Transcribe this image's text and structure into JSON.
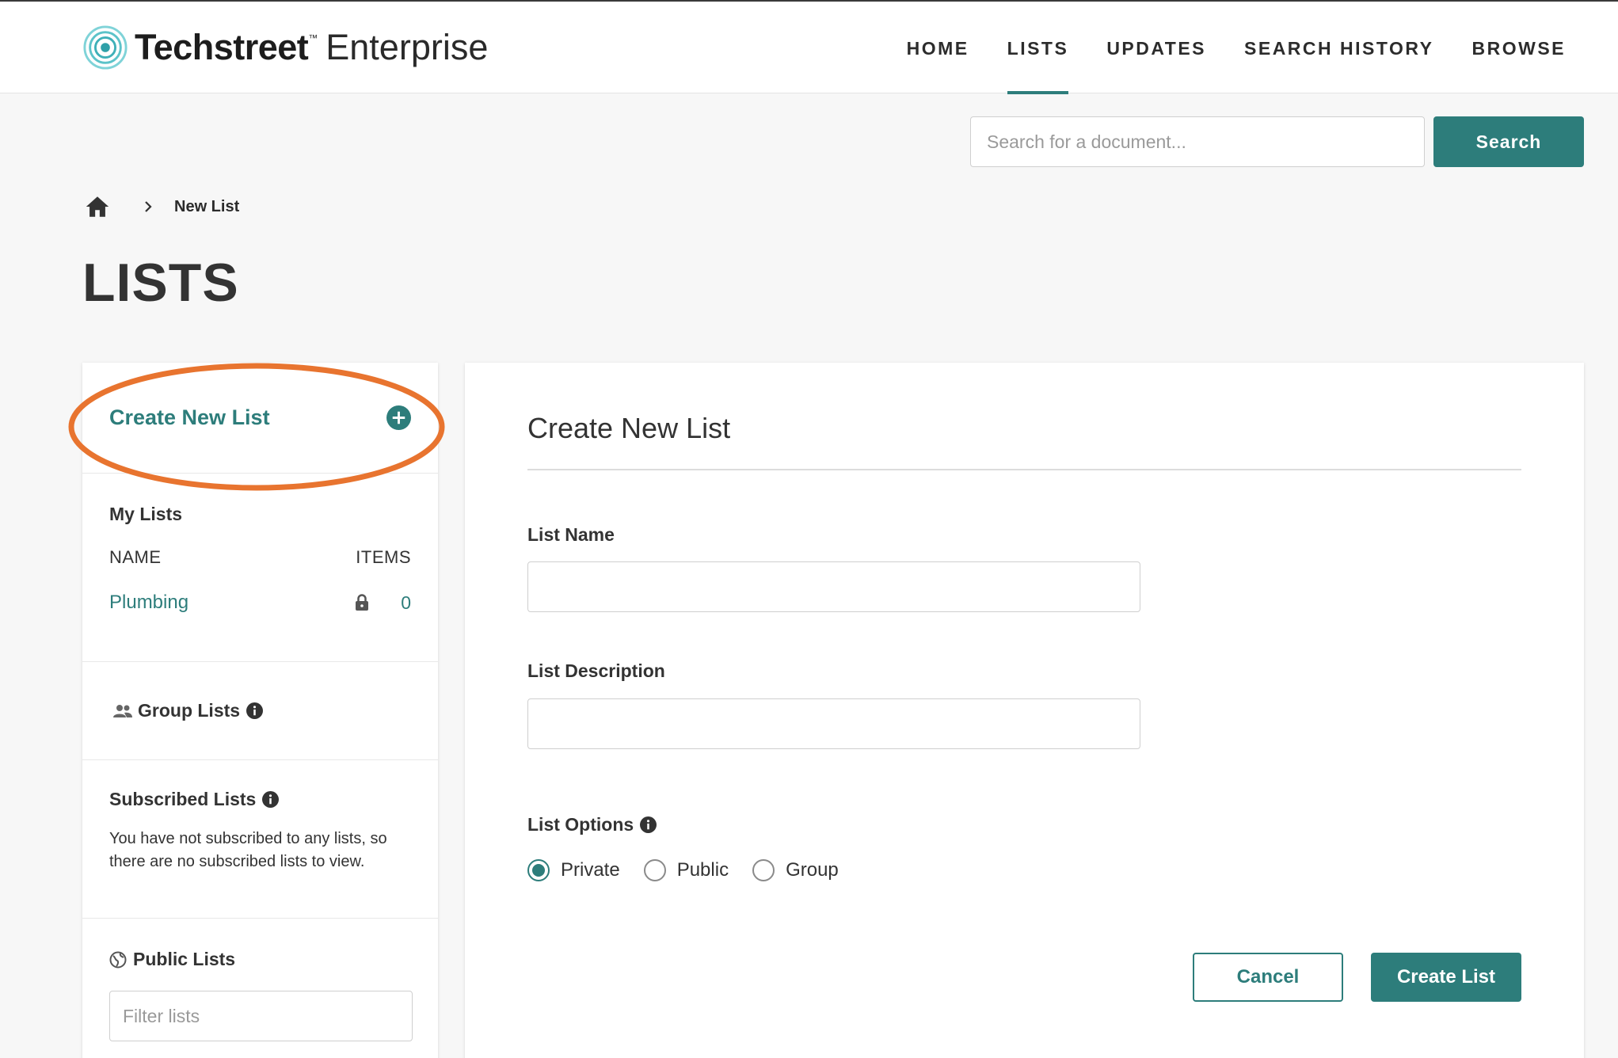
{
  "brand": {
    "name_bold": "Techstreet",
    "trademark": "™",
    "name_light": "Enterprise",
    "accent_color": "#2d7d7b",
    "highlight_color": "#e8742f"
  },
  "nav": {
    "items": [
      {
        "label": "HOME",
        "active": false
      },
      {
        "label": "LISTS",
        "active": true
      },
      {
        "label": "UPDATES",
        "active": false
      },
      {
        "label": "SEARCH HISTORY",
        "active": false
      },
      {
        "label": "BROWSE",
        "active": false
      }
    ]
  },
  "search": {
    "placeholder": "Search for a document...",
    "value": "",
    "button_label": "Search"
  },
  "breadcrumb": {
    "home_icon": "home-icon",
    "separator_icon": "chevron-right-icon",
    "current": "New List"
  },
  "page": {
    "title": "LISTS"
  },
  "sidebar": {
    "create_new_list": "Create New List",
    "create_icon": "plus-circle-icon",
    "my_lists": {
      "heading": "My Lists",
      "col_name": "NAME",
      "col_items": "ITEMS",
      "rows": [
        {
          "name": "Plumbing",
          "locked": true,
          "items": "0"
        }
      ]
    },
    "group_lists": {
      "heading": "Group Lists"
    },
    "subscribed_lists": {
      "heading": "Subscribed Lists",
      "empty_text": "You have not subscribed to any lists, so there are no subscribed lists to view."
    },
    "public_lists": {
      "heading": "Public Lists",
      "filter_placeholder": "Filter lists"
    }
  },
  "form": {
    "title": "Create New List",
    "list_name_label": "List Name",
    "list_name_value": "",
    "list_description_label": "List Description",
    "list_description_value": "",
    "list_options_label": "List Options",
    "options": [
      {
        "label": "Private",
        "checked": true
      },
      {
        "label": "Public",
        "checked": false
      },
      {
        "label": "Group",
        "checked": false
      }
    ],
    "cancel_label": "Cancel",
    "submit_label": "Create List"
  }
}
